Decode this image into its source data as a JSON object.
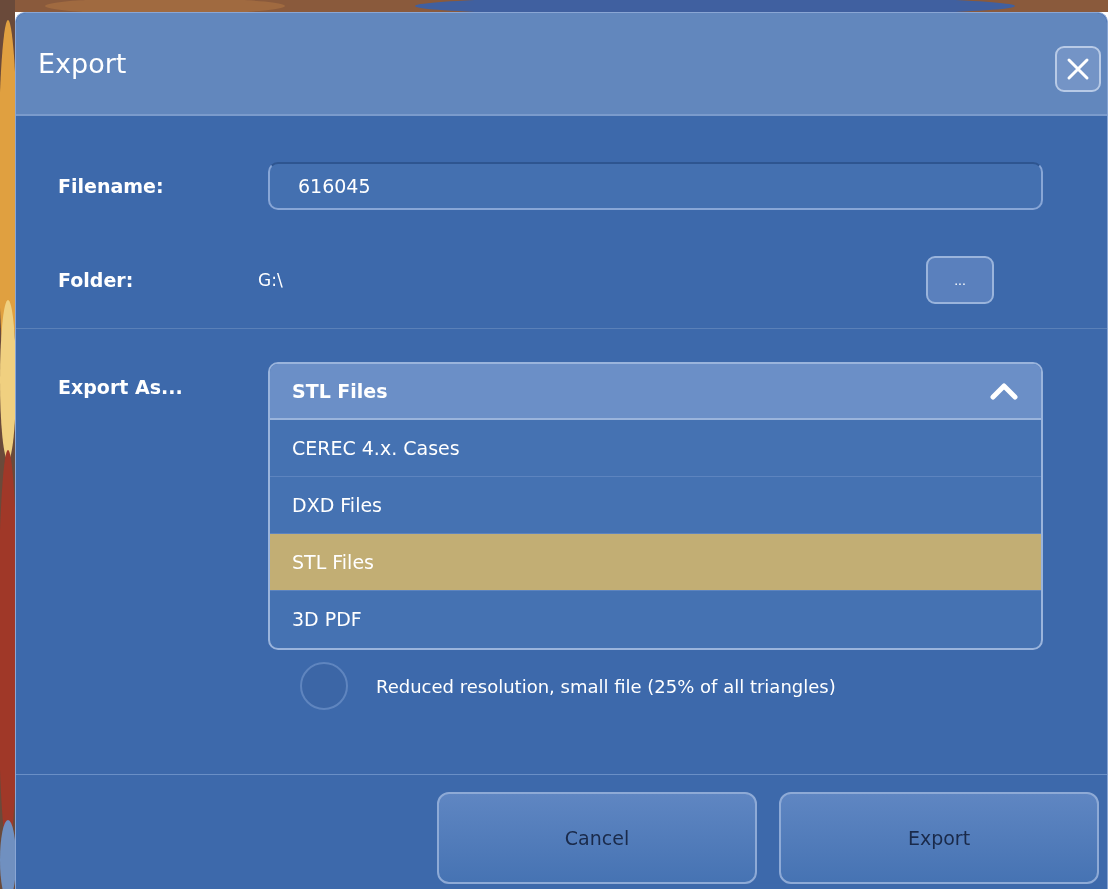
{
  "window": {
    "title": "Export"
  },
  "filename": {
    "label": "Filename:",
    "value": "616045"
  },
  "folder": {
    "label": "Folder:",
    "value": "G:\\",
    "browse_button": "..."
  },
  "export_as": {
    "label": "Export As...",
    "value": "STL Files",
    "expanded": true,
    "options": [
      {
        "label": "CEREC 4.x. Cases",
        "selected": false
      },
      {
        "label": "DXD Files",
        "selected": false
      },
      {
        "label": "STL Files",
        "selected": true
      },
      {
        "label": "3D PDF",
        "selected": false
      }
    ]
  },
  "reduced_resolution": {
    "label": "Reduced resolution, small file (25% of all triangles)",
    "checked": false
  },
  "buttons": [
    "Cancel",
    "Export"
  ]
}
